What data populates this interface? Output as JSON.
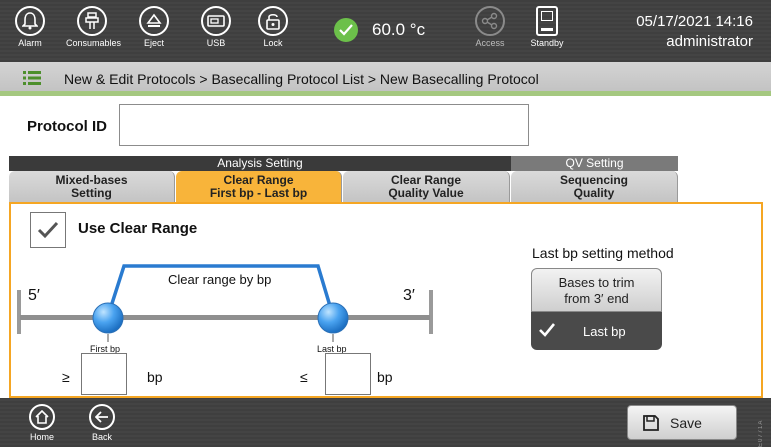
{
  "topbar": {
    "buttons": [
      {
        "label": "Alarm",
        "icon": "bell-icon"
      },
      {
        "label": "Consumables",
        "icon": "consumables-icon"
      },
      {
        "label": "Eject",
        "icon": "eject-icon"
      },
      {
        "label": "USB",
        "icon": "usb-icon"
      },
      {
        "label": "Lock",
        "icon": "lock-icon"
      }
    ],
    "temperature": "60.0 °c",
    "temperature_status_color": "#6cc04a",
    "access_label": "Access",
    "standby_label": "Standby",
    "datetime": "05/17/2021 14:16",
    "user": "administrator"
  },
  "breadcrumb": {
    "text": "New & Edit Protocols > Basecalling Protocol List > New Basecalling Protocol"
  },
  "protocol": {
    "id_label": "Protocol ID",
    "id_value": ""
  },
  "tabs": {
    "analysis_header": "Analysis Setting",
    "qv_header": "QV Setting",
    "items": [
      {
        "line1": "Mixed-bases",
        "line2": "Setting"
      },
      {
        "line1": "Clear Range",
        "line2": "First bp - Last bp"
      },
      {
        "line1": "Clear Range",
        "line2": "Quality Value"
      },
      {
        "line1": "Sequencing",
        "line2": "Quality"
      }
    ],
    "active_index": 1,
    "active_color": "#f8b43a"
  },
  "panel": {
    "use_clear_range_label": "Use Clear Range",
    "use_clear_range_checked": true,
    "diagram": {
      "five_prime": "5′",
      "three_prime": "3′",
      "range_label": "Clear range by bp",
      "first_bp_label": "First bp",
      "last_bp_label": "Last bp"
    },
    "first_bp": {
      "symbol": "≥",
      "unit": "bp",
      "value": ""
    },
    "last_bp": {
      "symbol": "≤",
      "unit": "bp",
      "value": ""
    },
    "last_bp_method": {
      "title": "Last bp setting method",
      "option_a_line1": "Bases to trim",
      "option_a_line2": "from 3′ end",
      "option_b": "Last bp",
      "selected": "Last bp"
    }
  },
  "bottombar": {
    "home_label": "Home",
    "back_label": "Back",
    "save_label": "Save",
    "figure_id": "E0771A"
  },
  "colors": {
    "accent_orange": "#f5a623",
    "line_blue": "#2a7bd0",
    "breadcrumb_green": "#a5c880"
  }
}
